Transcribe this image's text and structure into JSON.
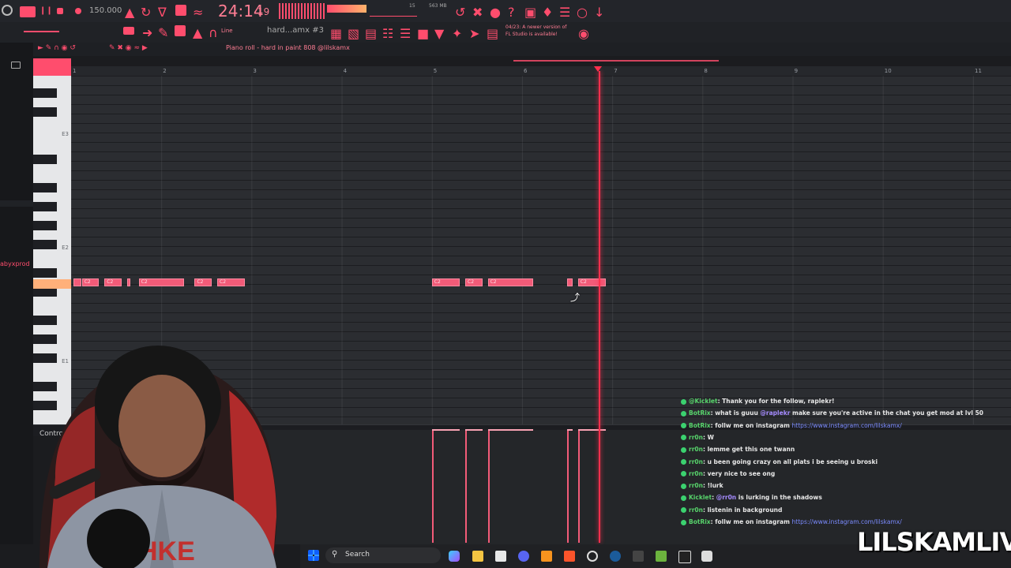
{
  "daw": {
    "tempo": "150.000",
    "time": "24:14",
    "time_sub": "19",
    "memory": "563 MB",
    "cpu_label": "15",
    "pattern_name": "hard...amx #3",
    "snap_mode": "Line",
    "hint_line1": "04/23: A newer version of",
    "hint_line2": "FL Studio is available!",
    "piano_roll_title": "Piano roll - hard in paint 808 @lilskamx",
    "control_label": "Control",
    "side_label": "abyxprod",
    "octave_labels": [
      "E3",
      "E2",
      "E1"
    ],
    "ruler": [
      "1",
      "2",
      "3",
      "4",
      "5",
      "6",
      "7",
      "8",
      "9",
      "10",
      "11"
    ],
    "note_label": "C2"
  },
  "notes": [
    {
      "start": 1.03,
      "len": 0.08
    },
    {
      "start": 1.12,
      "len": 0.19
    },
    {
      "start": 1.37,
      "len": 0.19
    },
    {
      "start": 1.62,
      "len": 0.04
    },
    {
      "start": 1.75,
      "len": 0.5
    },
    {
      "start": 2.37,
      "len": 0.19
    },
    {
      "start": 2.62,
      "len": 0.31
    },
    {
      "start": 5.0,
      "len": 0.31
    },
    {
      "start": 5.37,
      "len": 0.19
    },
    {
      "start": 5.62,
      "len": 0.5
    },
    {
      "start": 6.5,
      "len": 0.06
    },
    {
      "start": 6.62,
      "len": 0.31
    }
  ],
  "playhead_bar": 6.85,
  "chat": [
    {
      "user": "@Kicklet",
      "text": ": Thank you for the follow, raplekr!"
    },
    {
      "user": "BotRix",
      "text": ": what is guuu ",
      "mention": "@raplekr",
      "text2": " make sure you're active in the chat you get mod at lvl 50"
    },
    {
      "user": "BotRix",
      "text": ": follw me on instagram ",
      "link": "https://www.instagram.com/lilskamx/"
    },
    {
      "user": "rr0n",
      "text": ": W"
    },
    {
      "user": "rr0n",
      "text": ": lemme get this one twann"
    },
    {
      "user": "rr0n",
      "text": ": u been going crazy on all plats i be seeing u broski"
    },
    {
      "user": "rr0n",
      "text": ": very nice to see ong"
    },
    {
      "user": "rr0n",
      "text": ": !lurk"
    },
    {
      "user": "Kicklet",
      "text": ": ",
      "mention": "@rr0n",
      "text2": " is lurking in the shadows"
    },
    {
      "user": "rr0n",
      "text": ": listenin in background"
    },
    {
      "user": "BotRix",
      "text": ": follw me on instagram ",
      "link": "https://www.instagram.com/lilskamx/"
    }
  ],
  "taskbar": {
    "search_placeholder": "Search"
  },
  "watermark": "LILSKAMLIVE",
  "colors": {
    "accent": "#ff4d6d",
    "note": "#f25b78",
    "playhead": "#ff2f4d"
  }
}
